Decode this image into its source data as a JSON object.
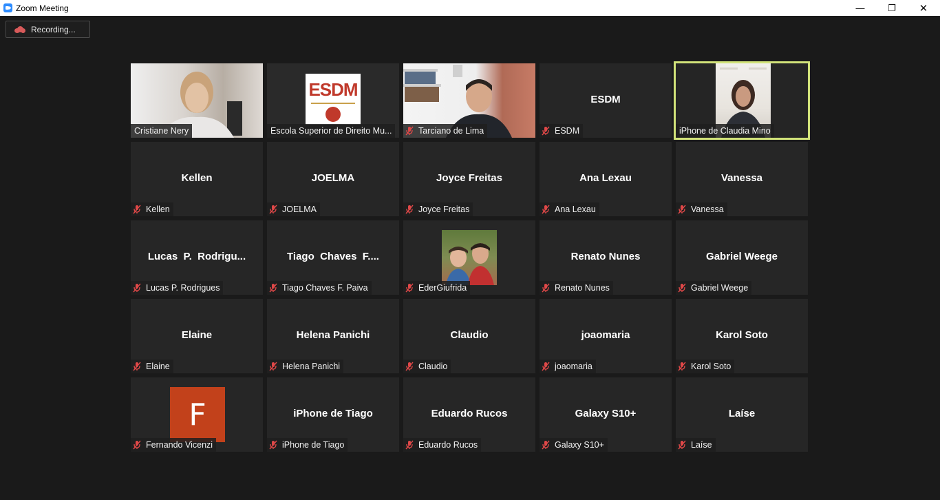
{
  "window": {
    "title": "Zoom Meeting",
    "minimize": "—",
    "restore": "❐",
    "close": "✕"
  },
  "recording": {
    "label": "Recording..."
  },
  "colors": {
    "background": "#1a1a1a",
    "tile": "#262626",
    "active_speaker_border": "#d2e37a",
    "muted_icon": "#e04848",
    "avatar_orange": "#c2411b"
  },
  "participants": [
    {
      "label": "Cristiane Nery",
      "muted": false
    },
    {
      "label": "Escola Superior de Direito Mu...",
      "muted": false,
      "logo_text": "ESDM"
    },
    {
      "label": "Tarciano de Lima",
      "muted": true
    },
    {
      "label": "ESDM",
      "display": "ESDM",
      "muted": true
    },
    {
      "label": "iPhone de Claudia Mino",
      "muted": false,
      "active": true
    },
    {
      "label": "Kellen",
      "display": "Kellen",
      "muted": true
    },
    {
      "label": "JOELMA",
      "display": "JOELMA",
      "muted": true
    },
    {
      "label": "Joyce Freitas",
      "display": "Joyce Freitas",
      "muted": true
    },
    {
      "label": "Ana Lexau",
      "display": "Ana Lexau",
      "muted": true
    },
    {
      "label": "Vanessa",
      "display": "Vanessa",
      "muted": true
    },
    {
      "label": "Lucas P. Rodrigues",
      "display": "Lucas  P.  Rodrigu...",
      "muted": true
    },
    {
      "label": "Tiago Chaves F. Paiva",
      "display": "Tiago  Chaves  F....",
      "muted": true
    },
    {
      "label": "EderGiufrida",
      "muted": true
    },
    {
      "label": "Renato Nunes",
      "display": "Renato Nunes",
      "muted": true
    },
    {
      "label": "Gabriel Weege",
      "display": "Gabriel Weege",
      "muted": true
    },
    {
      "label": "Elaine",
      "display": "Elaine",
      "muted": true
    },
    {
      "label": "Helena Panichi",
      "display": "Helena Panichi",
      "muted": true
    },
    {
      "label": "Claudio",
      "display": "Claudio",
      "muted": true
    },
    {
      "label": "joaomaria",
      "display": "joaomaria",
      "muted": true
    },
    {
      "label": "Karol Soto",
      "display": "Karol Soto",
      "muted": true
    },
    {
      "label": "Fernando Vicenzi",
      "muted": true,
      "avatar_letter": "F"
    },
    {
      "label": "iPhone de Tiago",
      "display": "iPhone de Tiago",
      "muted": true
    },
    {
      "label": "Eduardo Rucos",
      "display": "Eduardo Rucos",
      "muted": true
    },
    {
      "label": "Galaxy S10+",
      "display": "Galaxy S10+",
      "muted": true
    },
    {
      "label": "Laíse",
      "display": "Laíse",
      "muted": true
    }
  ]
}
